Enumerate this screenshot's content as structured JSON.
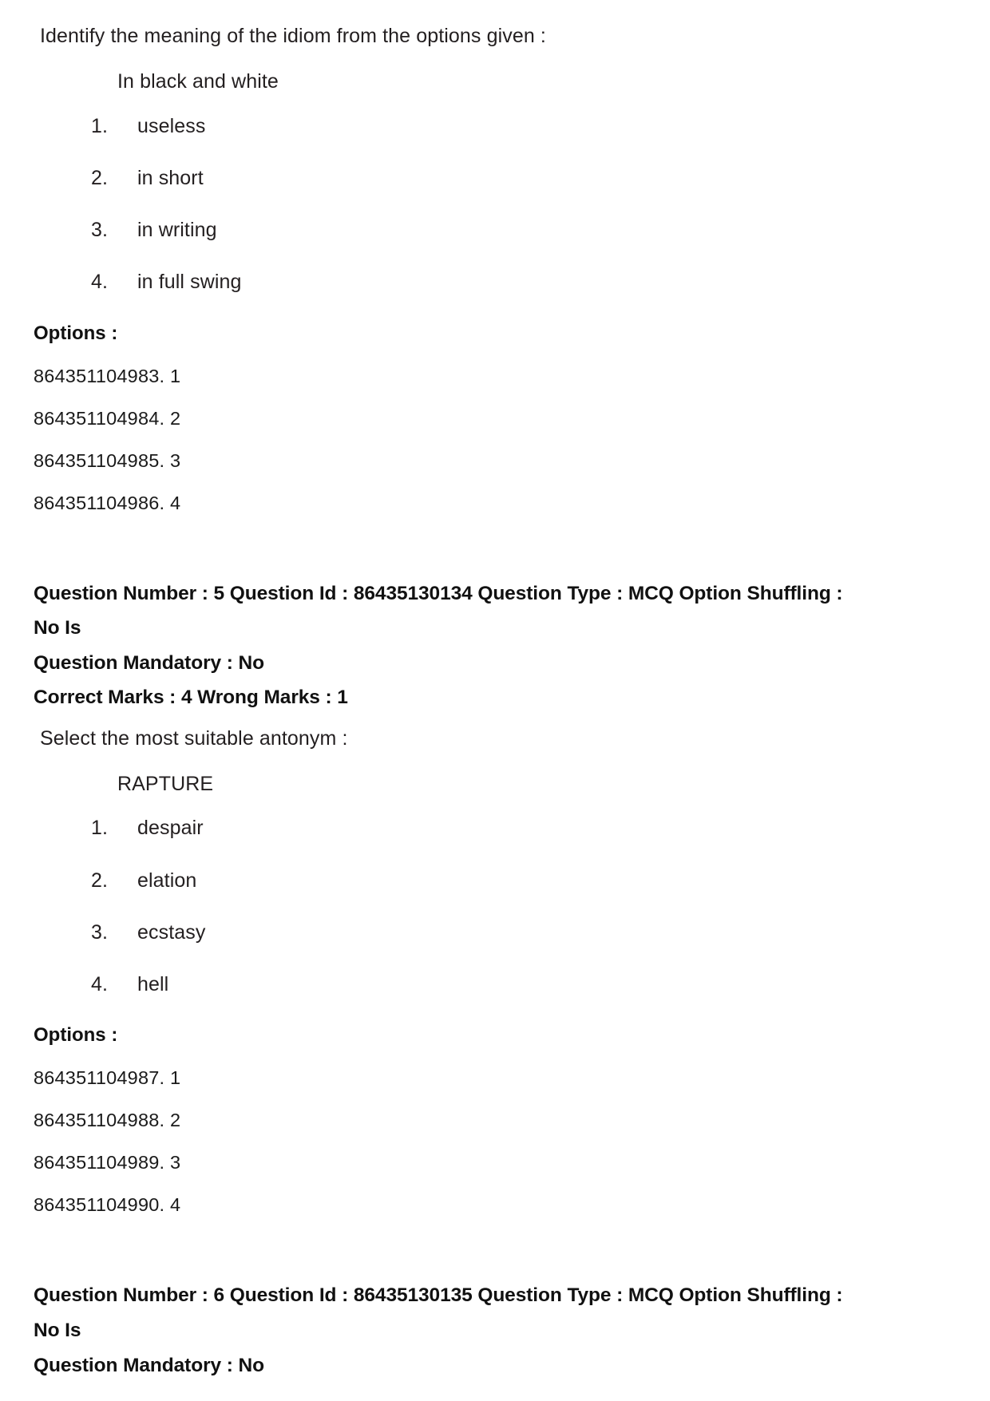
{
  "page": {
    "document_type": "exam-question-paper"
  },
  "questions": [
    {
      "stem": "Identify the meaning of the idiom from the options given :",
      "subject": "In black and white",
      "choices": [
        {
          "num": "1.",
          "text": "useless"
        },
        {
          "num": "2.",
          "text": "in short"
        },
        {
          "num": "3.",
          "text": "in writing"
        },
        {
          "num": "4.",
          "text": "in full swing"
        }
      ],
      "options_label": "Options :",
      "option_ids": [
        "864351104983. 1",
        "864351104984. 2",
        "864351104985. 3",
        "864351104986. 4"
      ]
    },
    {
      "header_line_1": "Question Number : 5 Question Id : 86435130134 Question Type : MCQ Option Shuffling : No Is",
      "header_line_2": "Question Mandatory : No",
      "header_line_3": "Correct Marks : 4 Wrong Marks : 1",
      "stem": "Select the most suitable antonym :",
      "subject": "RAPTURE",
      "choices": [
        {
          "num": "1.",
          "text": "despair"
        },
        {
          "num": "2.",
          "text": "elation"
        },
        {
          "num": "3.",
          "text": "ecstasy"
        },
        {
          "num": "4.",
          "text": "hell"
        }
      ],
      "options_label": "Options :",
      "option_ids": [
        "864351104987. 1",
        "864351104988. 2",
        "864351104989. 3",
        "864351104990. 4"
      ]
    },
    {
      "header_line_1": "Question Number : 6 Question Id : 86435130135 Question Type : MCQ Option Shuffling : No Is",
      "header_line_2": "Question Mandatory : No"
    }
  ]
}
